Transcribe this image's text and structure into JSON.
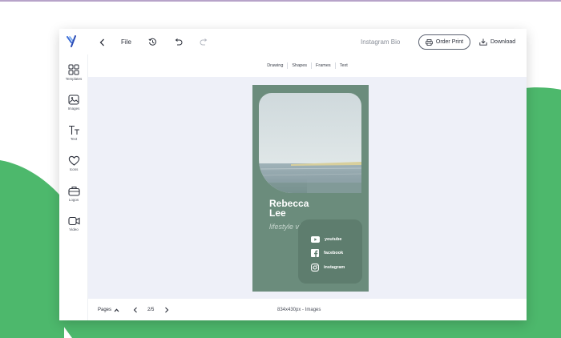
{
  "header": {
    "file_label": "File",
    "document_title": "Instagram Bio",
    "order_print_label": "Order Print",
    "download_label": "Download"
  },
  "sidebar": {
    "items": [
      {
        "label": "Templates",
        "icon": "templates-icon"
      },
      {
        "label": "Images",
        "icon": "image-icon"
      },
      {
        "label": "Text",
        "icon": "text-icon"
      },
      {
        "label": "Icons",
        "icon": "heart-icon"
      },
      {
        "label": "Logos",
        "icon": "briefcase-icon"
      },
      {
        "label": "Video",
        "icon": "video-camera-icon"
      }
    ]
  },
  "toolbar": {
    "items": [
      "Drawing",
      "Shapes",
      "Frames",
      "Text"
    ]
  },
  "card": {
    "name": "Rebecca Lee",
    "tagline": "lifestyle vlogs",
    "socials": [
      {
        "label": "youtube",
        "icon": "youtube-icon"
      },
      {
        "label": "facebook",
        "icon": "facebook-icon"
      },
      {
        "label": "instagram",
        "icon": "instagram-icon"
      }
    ]
  },
  "footer": {
    "pages_label": "Pages",
    "page_count": "2/5",
    "dimensions": "834x430px - Images"
  },
  "colors": {
    "accent_green": "#4db86c",
    "card_background": "#6b8c7c",
    "canvas_background": "#eef0f8"
  }
}
